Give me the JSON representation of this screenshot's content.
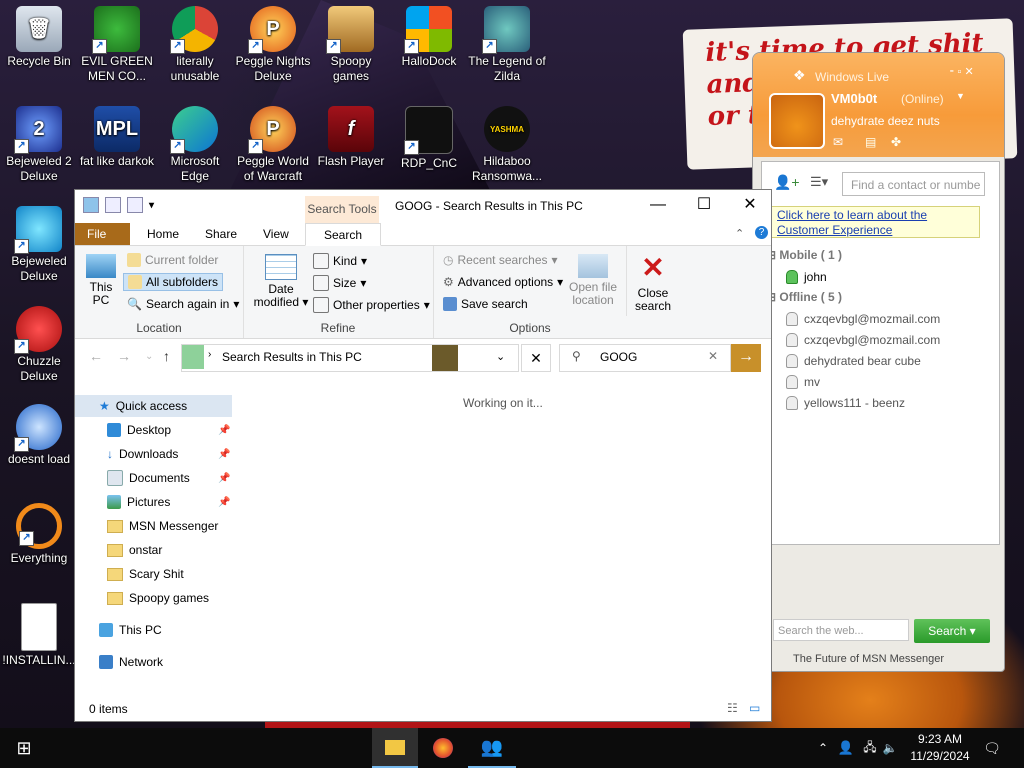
{
  "wallpaper": {
    "note_text": "it's time to get shit\nand\nor t"
  },
  "desktop_icons": [
    {
      "label": "Recycle Bin"
    },
    {
      "label": "EVIL GREEN MEN CO..."
    },
    {
      "label": "literally unusable"
    },
    {
      "label": "Peggle Nights Deluxe"
    },
    {
      "label": "Spoopy games"
    },
    {
      "label": "HalloDock"
    },
    {
      "label": "The Legend of Zilda"
    },
    {
      "label": "Bejeweled 2 Deluxe"
    },
    {
      "label": "fat like darkok"
    },
    {
      "label": "Microsoft Edge"
    },
    {
      "label": "Peggle World of Warcraft"
    },
    {
      "label": "Flash Player"
    },
    {
      "label": "RDP_CnC"
    },
    {
      "label": "Hildaboo Ransomwa..."
    },
    {
      "label": "Bejeweled Deluxe"
    },
    {
      "label": "Chuzzle Deluxe"
    },
    {
      "label": "doesnt load"
    },
    {
      "label": "Everything"
    },
    {
      "label": "!INSTALLIN..."
    }
  ],
  "explorer": {
    "title": "GOOG - Search Results in This PC",
    "context_tab": "Search Tools",
    "controls": {
      "minimize": "—",
      "maximize": "☐",
      "close": "✕"
    },
    "tabs": [
      "File",
      "Home",
      "Share",
      "View",
      "Search"
    ],
    "ribbon": {
      "location": {
        "label": "Location",
        "this_pc": "This PC",
        "current_folder": "Current folder",
        "all_subfolders": "All subfolders",
        "search_again": "Search again in"
      },
      "refine": {
        "label": "Refine",
        "date_modified": "Date modified",
        "kind": "Kind",
        "size": "Size",
        "other_properties": "Other properties"
      },
      "options": {
        "label": "Options",
        "recent_searches": "Recent searches",
        "advanced_options": "Advanced options",
        "save_search": "Save search",
        "open_file_location": "Open file location",
        "close_search": "Close search"
      }
    },
    "address": "Search Results in This PC",
    "search_value": "GOOG",
    "nav": {
      "quick_access": "Quick access",
      "items": [
        "Desktop",
        "Downloads",
        "Documents",
        "Pictures",
        "MSN Messenger",
        "onstar",
        "Scary Shit",
        "Spoopy games"
      ],
      "this_pc": "This PC",
      "network": "Network"
    },
    "status_message": "Working on it...",
    "status_bar": "0 items"
  },
  "msn": {
    "title": "Windows Live",
    "user": "VM0b0t",
    "status": "(Online)",
    "personal_message": "dehydrate deez nuts",
    "find_placeholder": "Find a contact or numbe",
    "info_link": "Click here to learn about the Customer Experience",
    "groups": [
      {
        "name": "Mobile ( 1 )",
        "contacts": [
          "john"
        ]
      },
      {
        "name": "Offline ( 5 )",
        "contacts": [
          "cxzqevbgl@mozmail.com",
          "cxzqevbgl@mozmail.com",
          "dehydrated bear cube",
          "mv",
          "yellows111 - beenz"
        ]
      }
    ],
    "web_search_placeholder": "Search the web...",
    "search_button": "Search",
    "footer": "The Future of MSN Messenger"
  },
  "taskbar": {
    "time": "9:23 AM",
    "date": "11/29/2024"
  }
}
